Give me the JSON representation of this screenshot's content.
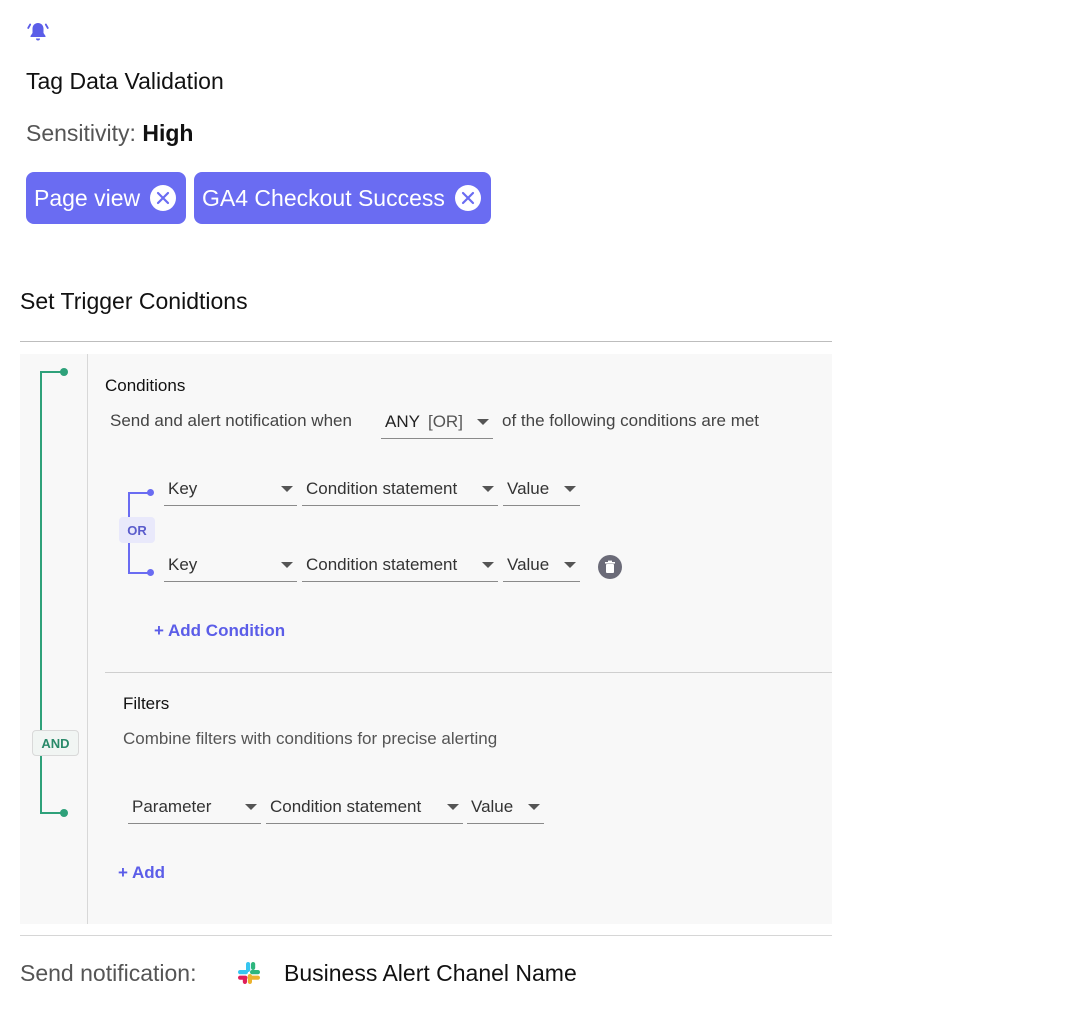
{
  "header": {
    "icon": "bell-alert-icon",
    "title": "Tag Data Validation",
    "sensitivity_label": "Sensitivity:",
    "sensitivity_value": "High"
  },
  "chips": [
    {
      "label": "Page view",
      "icon": "close-circle-icon"
    },
    {
      "label": "GA4 Checkout Success",
      "icon": "close-circle-icon"
    }
  ],
  "trigger": {
    "title": "Set Trigger Conidtions",
    "and_label": "AND",
    "conditions": {
      "heading": "Conditions",
      "desc_prefix": "Send and alert notification when",
      "match_value": "ANY",
      "match_sub": "[OR]",
      "desc_suffix": "of the following conditions are met",
      "or_label": "OR",
      "rows": [
        {
          "key": "Key",
          "condition": "Condition statement",
          "value": "Value"
        },
        {
          "key": "Key",
          "condition": "Condition statement",
          "value": "Value"
        }
      ],
      "add_label": "+ Add Condition"
    },
    "filters": {
      "heading": "Filters",
      "desc": "Combine filters with conditions for precise alerting",
      "row": {
        "param": "Parameter",
        "condition": "Condition statement",
        "value": "Value"
      },
      "add_label": "+ Add"
    }
  },
  "notification": {
    "label": "Send notification:",
    "icon": "slack-icon",
    "channel": "Business Alert Chanel Name"
  },
  "colors": {
    "accent": "#6a6cf2",
    "green": "#2ea17a",
    "link": "#5b5de8"
  }
}
